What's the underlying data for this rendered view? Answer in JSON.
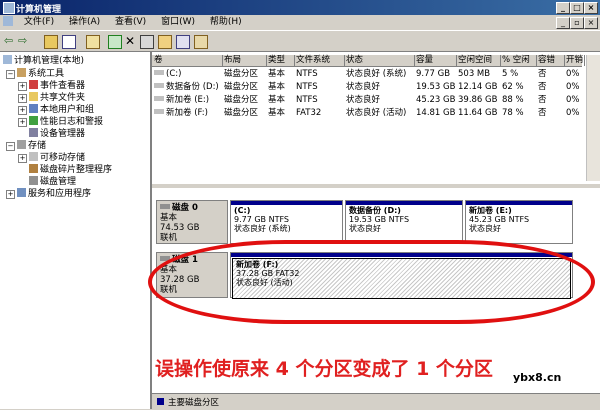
{
  "window": {
    "title": "计算机管理"
  },
  "menu": [
    "文件(F)",
    "操作(A)",
    "查看(V)",
    "窗口(W)",
    "帮助(H)"
  ],
  "tree": {
    "root": "计算机管理(本地)",
    "system_tools": "系统工具",
    "event_viewer": "事件查看器",
    "shared_folders": "共享文件夹",
    "local_users": "本地用户和组",
    "perf_logs": "性能日志和警报",
    "device_manager": "设备管理器",
    "storage": "存储",
    "removable": "可移动存储",
    "defrag": "磁盘碎片整理程序",
    "disk_mgmt": "磁盘管理",
    "services": "服务和应用程序"
  },
  "volume_columns": [
    "卷",
    "布局",
    "类型",
    "文件系统",
    "状态",
    "容量",
    "空闲空间",
    "% 空闲",
    "容错",
    "开销"
  ],
  "volumes": [
    [
      "(C:)",
      "磁盘分区",
      "基本",
      "NTFS",
      "状态良好 (系统)",
      "9.77 GB",
      "503 MB",
      "5 %",
      "否",
      "0%"
    ],
    [
      "数据备份 (D:)",
      "磁盘分区",
      "基本",
      "NTFS",
      "状态良好",
      "19.53 GB",
      "12.14 GB",
      "62 %",
      "否",
      "0%"
    ],
    [
      "新加卷 (E:)",
      "磁盘分区",
      "基本",
      "NTFS",
      "状态良好",
      "45.23 GB",
      "39.86 GB",
      "88 %",
      "否",
      "0%"
    ],
    [
      "新加卷 (F:)",
      "磁盘分区",
      "基本",
      "FAT32",
      "状态良好 (活动)",
      "14.81 GB",
      "11.64 GB",
      "78 %",
      "否",
      "0%"
    ]
  ],
  "disk0": {
    "name": "磁盘 0",
    "type": "基本",
    "size": "74.53 GB",
    "status": "联机",
    "parts": [
      {
        "name": "(C:)",
        "detail": "9.77 GB NTFS",
        "status": "状态良好 (系统)"
      },
      {
        "name": "数据备份 (D:)",
        "detail": "19.53 GB NTFS",
        "status": "状态良好"
      },
      {
        "name": "新加卷 (E:)",
        "detail": "45.23 GB NTFS",
        "status": "状态良好"
      }
    ]
  },
  "disk1": {
    "name": "磁盘 1",
    "type": "基本",
    "size": "37.28 GB",
    "status": "联机",
    "part": {
      "name": "新加卷 (F:)",
      "detail": "37.28 GB FAT32",
      "status": "状态良好 (活动)"
    }
  },
  "legend": "主要磁盘分区",
  "caption": "误操作使原来 4 个分区变成了 1 个分区",
  "watermark": "ybx8.cn",
  "colors": {
    "titlebar": "#0a246a",
    "partition_bar": "#00008b",
    "annotation": "#e02020"
  }
}
